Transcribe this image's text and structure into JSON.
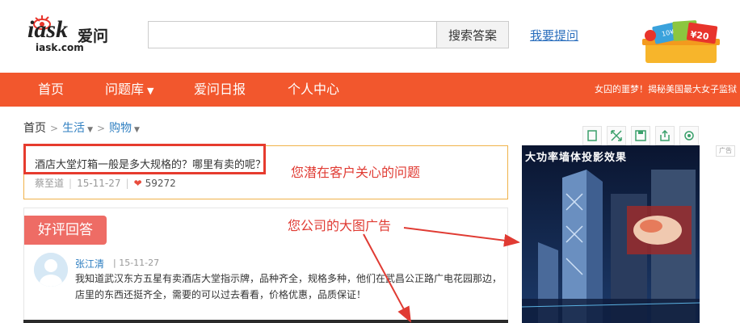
{
  "header": {
    "logo_text": "iask",
    "logo_cn": "爱问",
    "logo_url": "iask.com",
    "search_placeholder": "",
    "search_button": "搜索答案",
    "ask_link": "我要提问",
    "promo_amount": "¥20",
    "promo_small": "10¥"
  },
  "nav": {
    "items": [
      {
        "label": "首页"
      },
      {
        "label": "问题库"
      },
      {
        "label": "爱问日报"
      },
      {
        "label": "个人中心"
      }
    ],
    "news": "女囚的噩梦！揭秘美国最大女子监狱"
  },
  "breadcrumb": {
    "home": "首页",
    "level1": "生活",
    "level2": "购物"
  },
  "question": {
    "title": "酒店大堂灯箱一般是多大规格的？哪里有卖的呢？",
    "author": "蔡至道",
    "date": "15-11-27",
    "views": "59272"
  },
  "annotations": {
    "note1": "您潜在客户关心的问题",
    "note2": "您公司的大图广告"
  },
  "answer": {
    "badge": "好评回答",
    "name": "张江清",
    "date": "15-11-27",
    "text": "我知道武汉东方五星有卖酒店大堂指示牌，品种齐全，规格多种，他们在武昌公正路广电花园那边，店里的东西还挺齐全，需要的可以过去看看，价格优惠，品质保证！"
  },
  "ad": {
    "title": "大功率墙体投影效果",
    "tag": "广告"
  },
  "colors": {
    "nav_bg": "#f2572d",
    "link": "#2f7fc1",
    "annotation_red": "#e03b33",
    "badge": "#ee6c65"
  }
}
